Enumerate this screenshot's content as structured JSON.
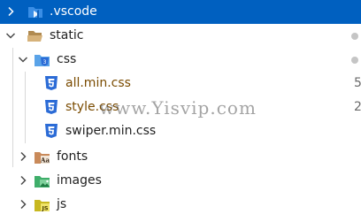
{
  "explorer": {
    "rows": [
      {
        "label": ".vscode",
        "expanded": false,
        "selected": true,
        "icon": "vscode-folder-icon"
      },
      {
        "label": "static",
        "expanded": true,
        "icon": "folder-open-icon",
        "indicator": "dot"
      },
      {
        "label": "css",
        "expanded": true,
        "icon": "css-folder-icon",
        "indicator": "dot"
      },
      {
        "label": "all.min.css",
        "icon": "css3-file-icon",
        "badge": "5"
      },
      {
        "label": "style.css",
        "icon": "css3-file-icon",
        "badge": "2"
      },
      {
        "label": "swiper.min.css",
        "icon": "css3-file-icon"
      },
      {
        "label": "fonts",
        "expanded": false,
        "icon": "fonts-folder-icon"
      },
      {
        "label": "images",
        "expanded": false,
        "icon": "images-folder-icon"
      },
      {
        "label": "js",
        "expanded": false,
        "icon": "js-folder-icon"
      }
    ]
  },
  "watermark": "www.Yisvip.com",
  "colors": {
    "selection": "#0060c0",
    "css_icon": "#2b6bd6",
    "folder": "#c9a36a",
    "images_folder": "#3fae6a",
    "js_folder": "#c8b820",
    "modified_dot": "#c5c5c5"
  }
}
